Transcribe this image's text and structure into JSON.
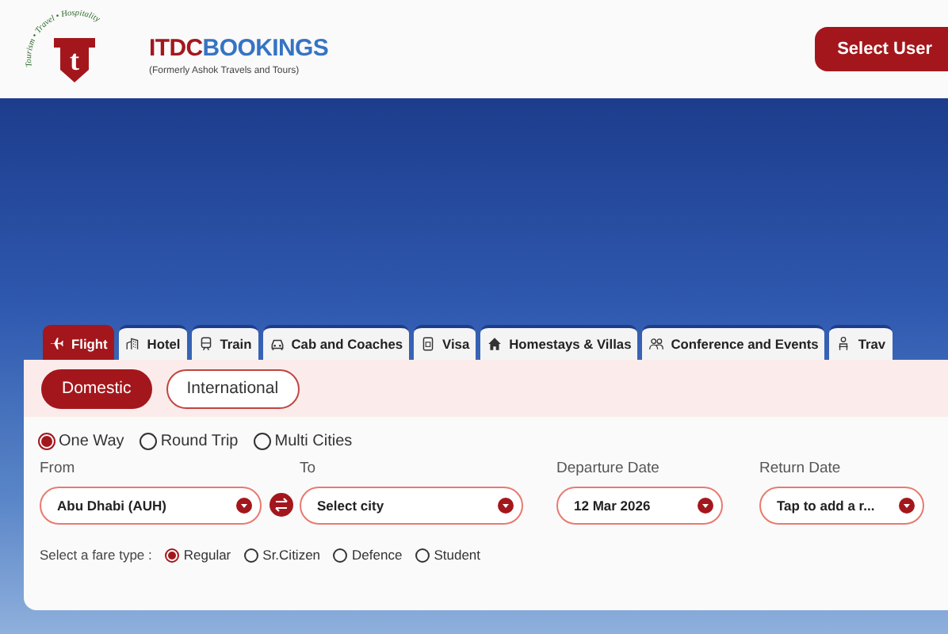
{
  "header": {
    "logo_tagline": "Tourism • Travel • Hospitality",
    "logo_letter": "t",
    "brand_part1": "ITDC",
    "brand_part2": "BOOKINGS",
    "subtitle": "(Formerly Ashok Travels and Tours)",
    "user_button": "Select User"
  },
  "tabs": [
    {
      "label": "Flight",
      "kind": "plane",
      "selected": true
    },
    {
      "label": "Hotel",
      "kind": "building",
      "selected": false
    },
    {
      "label": "Train",
      "kind": "train",
      "selected": false
    },
    {
      "label": "Cab and Coaches",
      "kind": "car",
      "selected": false
    },
    {
      "label": "Visa",
      "kind": "card",
      "selected": false
    },
    {
      "label": "Homestays & Villas",
      "kind": "house",
      "selected": false
    },
    {
      "label": "Conference and Events",
      "kind": "people",
      "selected": false
    },
    {
      "label": "Trav",
      "kind": "person",
      "selected": false
    }
  ],
  "scope": [
    {
      "label": "Domestic",
      "selected": true
    },
    {
      "label": "International",
      "selected": false
    }
  ],
  "trip_types": [
    {
      "label": "One Way",
      "selected": true
    },
    {
      "label": "Round Trip",
      "selected": false
    },
    {
      "label": "Multi Cities",
      "selected": false
    }
  ],
  "fields": [
    {
      "label": "From",
      "value": "Abu Dhabi (AUH)"
    },
    {
      "label": "To",
      "value": "Select city"
    },
    {
      "label": "Departure Date",
      "value": "12 Mar 2026"
    },
    {
      "label": "Return Date",
      "value": "Tap to add a r..."
    }
  ],
  "fare_type": {
    "label": "Select a fare type :",
    "options": [
      {
        "label": "Regular",
        "selected": true
      },
      {
        "label": "Sr.Citizen",
        "selected": false
      },
      {
        "label": "Defence",
        "selected": false
      },
      {
        "label": "Student",
        "selected": false
      }
    ]
  }
}
